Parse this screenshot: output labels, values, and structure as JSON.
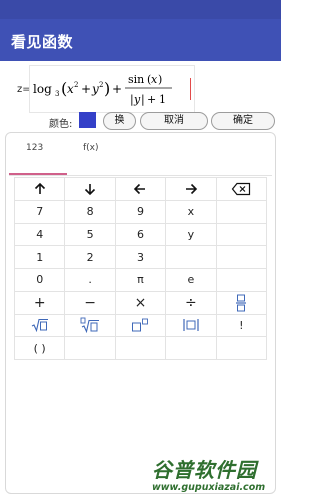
{
  "app": {
    "title": "看见函数"
  },
  "formula": {
    "z_label": "z=",
    "latex": "log3(x^2+y^2) + sin(x)/(|y|+1)"
  },
  "color_row": {
    "label": "颜色:",
    "swatch_color": "#3440c8",
    "swap_label": "换",
    "cancel_label": "取消",
    "ok_label": "确定"
  },
  "keyboard": {
    "tabs": [
      {
        "label": "123",
        "selected": true
      },
      {
        "label": "f(x)",
        "selected": false
      }
    ],
    "rows": [
      [
        "up-arrow",
        "down-arrow",
        "left-arrow",
        "right-arrow",
        "backspace"
      ],
      [
        "7",
        "8",
        "9",
        "x",
        ""
      ],
      [
        "4",
        "5",
        "6",
        "y",
        ""
      ],
      [
        "1",
        "2",
        "3",
        "",
        ""
      ],
      [
        "0",
        ".",
        "π",
        "e",
        ""
      ],
      [
        "+",
        "−",
        "×",
        "÷",
        "fraction"
      ],
      [
        "sqrt",
        "nthroot",
        "power",
        "abs",
        "!"
      ],
      [
        "( )",
        "",
        "",
        "",
        ""
      ]
    ],
    "labels": {
      "r1c0": "7",
      "r1c1": "8",
      "r1c2": "9",
      "r1c3": "x",
      "r2c0": "4",
      "r2c1": "5",
      "r2c2": "6",
      "r2c3": "y",
      "r3c0": "1",
      "r3c1": "2",
      "r3c2": "3",
      "r4c0": "0",
      "r4c1": ".",
      "r4c2": "π",
      "r4c3": "e",
      "r5c0": "+",
      "r5c1": "−",
      "r5c2": "×",
      "r5c3": "÷",
      "r6c4": "!",
      "r7c0": "( )"
    }
  },
  "watermark": {
    "text": "谷普软件园",
    "url": "www.gupuxiazai.com"
  }
}
